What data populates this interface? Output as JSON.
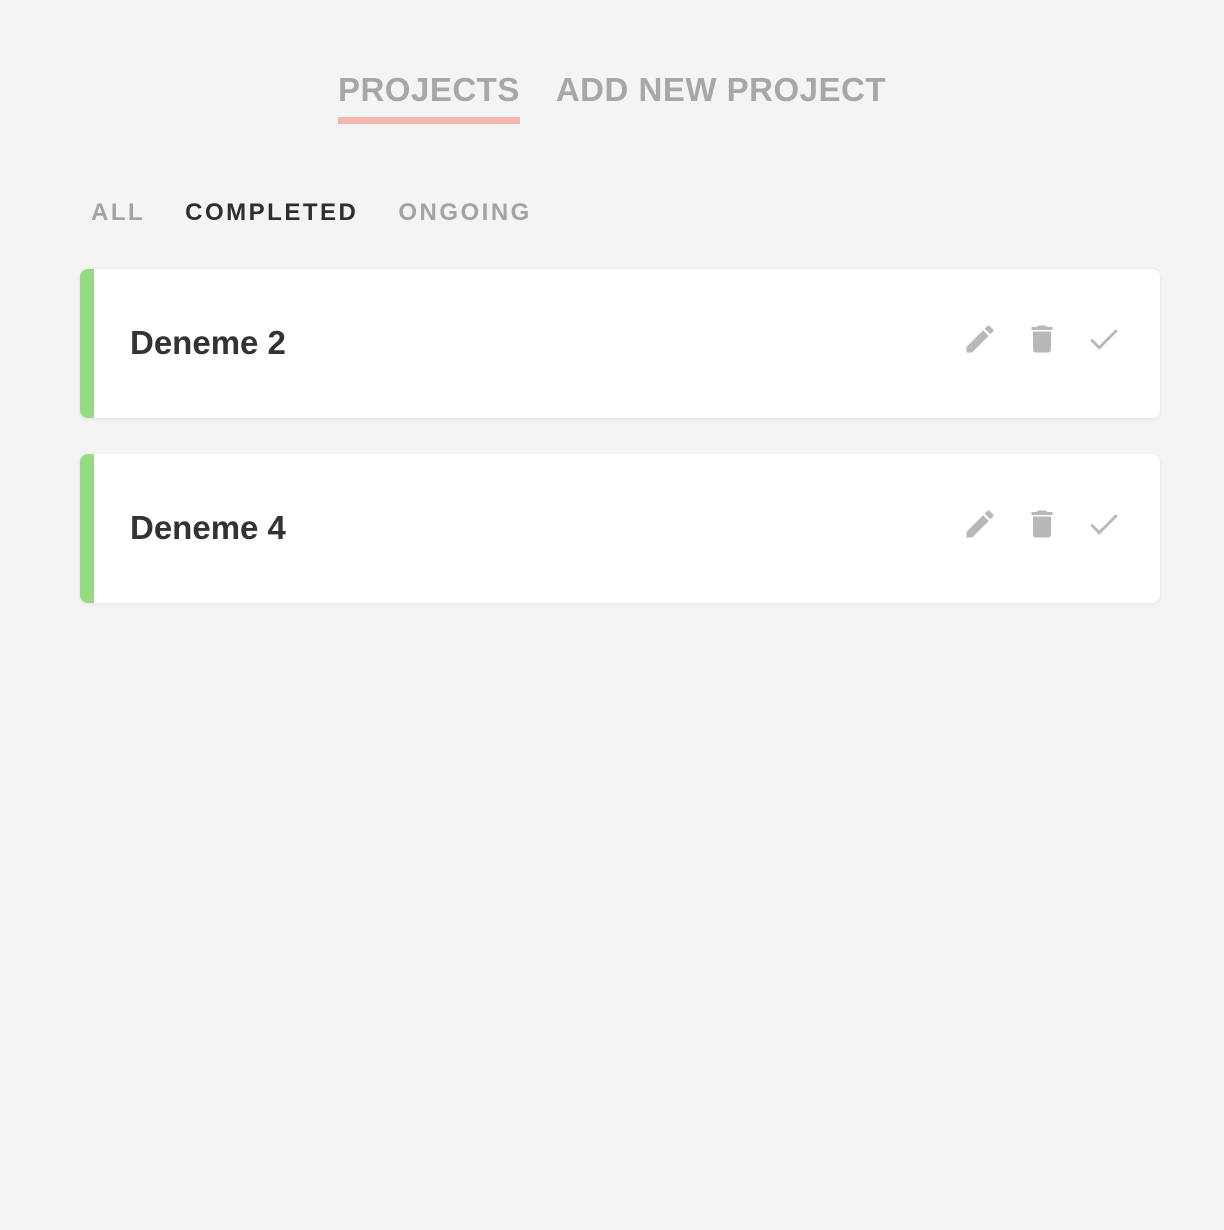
{
  "nav": {
    "projects_label": "PROJECTS",
    "add_new_label": "ADD NEW PROJECT"
  },
  "filters": {
    "all_label": "ALL",
    "completed_label": "COMPLETED",
    "ongoing_label": "ONGOING",
    "active": "COMPLETED"
  },
  "projects": [
    {
      "title": "Deneme 2",
      "status": "completed"
    },
    {
      "title": "Deneme 4",
      "status": "completed"
    }
  ],
  "icons": {
    "edit": "pencil-icon",
    "delete": "trash-icon",
    "complete": "check-icon"
  },
  "colors": {
    "background": "#f4f4f4",
    "nav_text": "#a7a7a7",
    "nav_underline": "#f5b6b0",
    "filter_active": "#2e2e2e",
    "filter_inactive": "#a3a3a3",
    "card_bg": "#ffffff",
    "status_completed": "#95db84",
    "icon": "#b8b8b8",
    "title_text": "#333333"
  }
}
